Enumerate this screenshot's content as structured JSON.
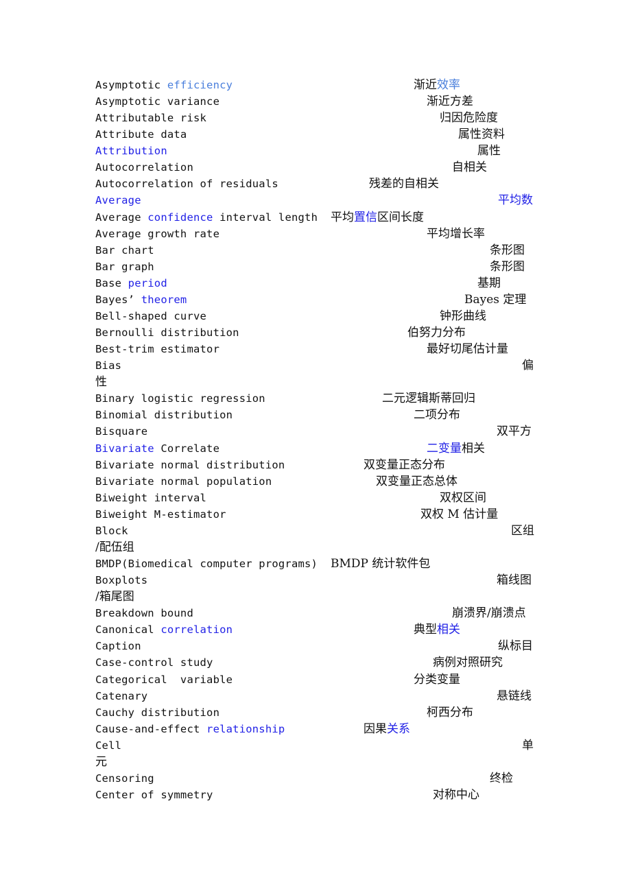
{
  "document": {
    "entries": [
      {
        "en": [
          {
            "t": "Asymptotic "
          },
          {
            "t": "efficiency",
            "c": "lblue"
          }
        ],
        "zh": [
          {
            "t": "渐近"
          },
          {
            "t": "效率",
            "c": "lblue"
          }
        ]
      },
      {
        "en": [
          {
            "t": "Asymptotic variance"
          }
        ],
        "zh": [
          {
            "t": "渐近方差"
          }
        ]
      },
      {
        "en": [
          {
            "t": "Attributable risk"
          }
        ],
        "zh": [
          {
            "t": "归因危险度"
          }
        ]
      },
      {
        "en": [
          {
            "t": "Attribute data"
          }
        ],
        "zh": [
          {
            "t": "属性资料"
          }
        ]
      },
      {
        "en": [
          {
            "t": "Attribution",
            "c": "blue"
          }
        ],
        "zh": [
          {
            "t": "属性"
          }
        ]
      },
      {
        "en": [
          {
            "t": "Autocorrelation"
          }
        ],
        "zh": [
          {
            "t": "自相关"
          }
        ]
      },
      {
        "en": [
          {
            "t": "Autocorrelation of residuals"
          }
        ],
        "zh": [
          {
            "t": "残差的自相关"
          }
        ]
      },
      {
        "en": [
          {
            "t": "Average",
            "c": "blue"
          }
        ],
        "zh": [
          {
            "t": "平均数",
            "c": "blue"
          }
        ]
      },
      {
        "en": [
          {
            "t": "Average "
          },
          {
            "t": "confidence",
            "c": "blue"
          },
          {
            "t": " interval length"
          }
        ],
        "zh": [
          {
            "t": "平均"
          },
          {
            "t": "置信",
            "c": "blue"
          },
          {
            "t": "区间长度"
          }
        ]
      },
      {
        "en": [
          {
            "t": "Average growth rate"
          }
        ],
        "zh": [
          {
            "t": "平均增长率"
          }
        ]
      },
      {
        "en": [
          {
            "t": "Bar chart"
          }
        ],
        "zh": [
          {
            "t": "条形图"
          }
        ]
      },
      {
        "en": [
          {
            "t": "Bar graph"
          }
        ],
        "zh": [
          {
            "t": "条形图"
          }
        ]
      },
      {
        "en": [
          {
            "t": "Base "
          },
          {
            "t": "period",
            "c": "blue"
          }
        ],
        "zh": [
          {
            "t": "基期"
          }
        ]
      },
      {
        "en": [
          {
            "t": "Bayes’ "
          },
          {
            "t": "theorem",
            "c": "blue"
          }
        ],
        "zh": [
          {
            "t": "Bayes 定理"
          }
        ]
      },
      {
        "en": [
          {
            "t": "Bell-shaped curve"
          }
        ],
        "zh": [
          {
            "t": "钟形曲线"
          }
        ]
      },
      {
        "en": [
          {
            "t": "Bernoulli distribution"
          }
        ],
        "zh": [
          {
            "t": "伯努力分布"
          }
        ]
      },
      {
        "en": [
          {
            "t": "Best-trim estimator"
          }
        ],
        "zh": [
          {
            "t": "最好切尾估计量"
          }
        ]
      },
      {
        "en": [
          {
            "t": "Bias"
          }
        ],
        "zh": [
          {
            "t": "偏"
          }
        ],
        "wrap": "性"
      },
      {
        "en": [
          {
            "t": "Binary logistic regression"
          }
        ],
        "zh": [
          {
            "t": "二元逻辑斯蒂回归"
          }
        ]
      },
      {
        "en": [
          {
            "t": "Binomial distribution"
          }
        ],
        "zh": [
          {
            "t": "二项分布"
          }
        ]
      },
      {
        "en": [
          {
            "t": "Bisquare"
          }
        ],
        "zh": [
          {
            "t": "双平方"
          }
        ]
      },
      {
        "en": [
          {
            "t": "Bivariate",
            "c": "blue"
          },
          {
            "t": " Correlate"
          }
        ],
        "zh": [
          {
            "t": "二变量",
            "c": "blue"
          },
          {
            "t": "相关"
          }
        ]
      },
      {
        "en": [
          {
            "t": "Bivariate normal distribution"
          }
        ],
        "zh": [
          {
            "t": "双变量正态分布"
          }
        ]
      },
      {
        "en": [
          {
            "t": "Bivariate normal population"
          }
        ],
        "zh": [
          {
            "t": "双变量正态总体"
          }
        ]
      },
      {
        "en": [
          {
            "t": "Biweight interval"
          }
        ],
        "zh": [
          {
            "t": "双权区间"
          }
        ]
      },
      {
        "en": [
          {
            "t": "Biweight M-estimator"
          }
        ],
        "zh": [
          {
            "t": "双权 M 估计量"
          }
        ]
      },
      {
        "en": [
          {
            "t": "Block"
          }
        ],
        "zh": [
          {
            "t": "区组"
          }
        ],
        "wrap": "/配伍组"
      },
      {
        "en": [
          {
            "t": "BMDP(Biomedical computer programs)"
          }
        ],
        "zh": [
          {
            "t": "BMDP 统计软件包"
          }
        ]
      },
      {
        "en": [
          {
            "t": "Boxplots"
          }
        ],
        "zh": [
          {
            "t": "箱线图"
          }
        ],
        "wrap": "/箱尾图"
      },
      {
        "en": [
          {
            "t": "Breakdown bound"
          }
        ],
        "zh": [
          {
            "t": "崩溃界/崩溃点"
          }
        ]
      },
      {
        "en": [
          {
            "t": "Canonical "
          },
          {
            "t": "correlation",
            "c": "blue"
          }
        ],
        "zh": [
          {
            "t": "典型"
          },
          {
            "t": "相关",
            "c": "blue"
          }
        ]
      },
      {
        "en": [
          {
            "t": "Caption"
          }
        ],
        "zh": [
          {
            "t": "纵标目"
          }
        ]
      },
      {
        "en": [
          {
            "t": "Case-control study"
          }
        ],
        "zh": [
          {
            "t": "病例对照研究"
          }
        ]
      },
      {
        "en": [
          {
            "t": "Categorical  variable"
          }
        ],
        "zh": [
          {
            "t": "分类变量"
          }
        ]
      },
      {
        "en": [
          {
            "t": "Catenary"
          }
        ],
        "zh": [
          {
            "t": "悬链线"
          }
        ]
      },
      {
        "en": [
          {
            "t": "Cauchy distribution"
          }
        ],
        "zh": [
          {
            "t": "柯西分布"
          }
        ]
      },
      {
        "en": [
          {
            "t": "Cause-and-effect "
          },
          {
            "t": "relationship",
            "c": "blue"
          }
        ],
        "zh": [
          {
            "t": "因果"
          },
          {
            "t": "关系",
            "c": "blue"
          }
        ]
      },
      {
        "en": [
          {
            "t": "Cell"
          }
        ],
        "zh": [
          {
            "t": "单"
          }
        ],
        "wrap": "元"
      },
      {
        "en": [
          {
            "t": "Censoring"
          }
        ],
        "zh": [
          {
            "t": "终检"
          }
        ]
      },
      {
        "en": [
          {
            "t": "Center of symmetry"
          }
        ],
        "zh": [
          {
            "t": "对称中心"
          }
        ]
      }
    ]
  }
}
